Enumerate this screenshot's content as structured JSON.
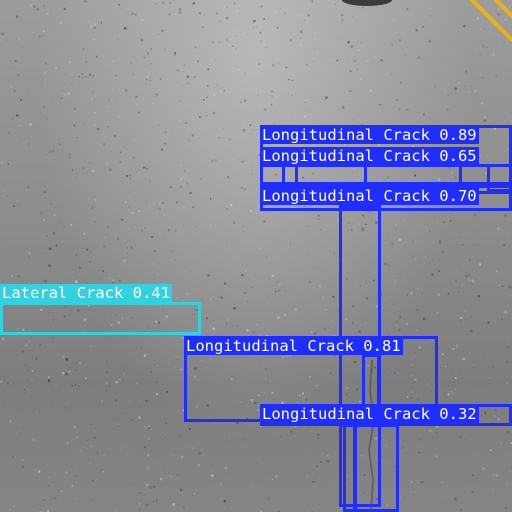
{
  "image": {
    "scene": "asphalt road surface with crack detections",
    "lane_line_color": "#e8b21c",
    "longitudinal_color": "#1f2eff",
    "lateral_color": "#33d0e0"
  },
  "detections": [
    {
      "class": "Longitudinal Crack",
      "confidence": "0.89",
      "text": "Longitudinal Crack 0.89"
    },
    {
      "class": "Longitudinal Crack",
      "confidence": "0.65",
      "text": "Longitudinal Crack 0.65"
    },
    {
      "class": "Longitudinal Crack",
      "confidence": "0.70",
      "text": "Longitudinal Crack 0.70"
    },
    {
      "class": "Lateral Crack",
      "confidence": "0.41",
      "text": "Lateral Crack 0.41"
    },
    {
      "class": "Longitudinal Crack",
      "confidence": "0.81",
      "text": "Longitudinal Crack 0.81"
    },
    {
      "class": "Longitudinal Crack",
      "confidence": "0.32",
      "text": "Longitudinal Crack 0.32"
    }
  ]
}
